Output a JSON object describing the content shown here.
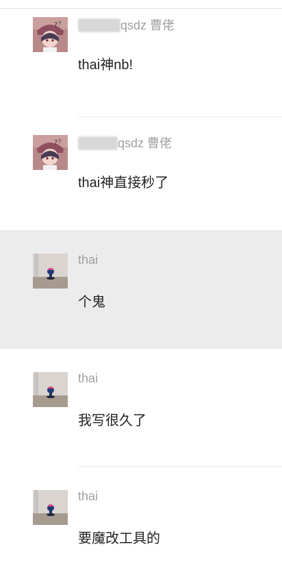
{
  "messages": [
    {
      "sender_visible": "qsdz 曹佬",
      "text": "thai神nb!",
      "highlighted": false,
      "avatar": "anime-girl-avatar-icon"
    },
    {
      "sender_visible": "qsdz 曹佬",
      "text": "thai神直接秒了",
      "highlighted": false,
      "avatar": "anime-girl-avatar-icon"
    },
    {
      "sender_visible": "thai",
      "text": "个鬼",
      "highlighted": true,
      "avatar": "figurine-avatar-icon"
    },
    {
      "sender_visible": "thai",
      "text": "我写很久了",
      "highlighted": false,
      "avatar": "figurine-avatar-icon"
    },
    {
      "sender_visible": "thai",
      "text": "要魔改工具的",
      "highlighted": false,
      "avatar": "figurine-avatar-icon"
    }
  ],
  "colors": {
    "sender": "#a0a0a0",
    "text": "#222222",
    "highlight_bg": "#ececec"
  }
}
